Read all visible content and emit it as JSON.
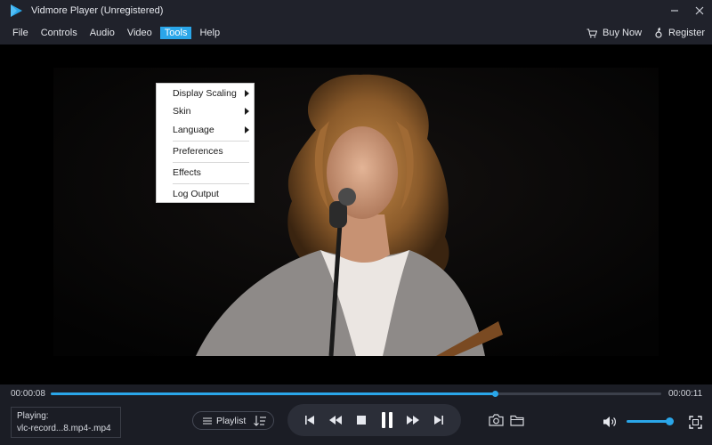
{
  "window": {
    "title": "Vidmore Player (Unregistered)",
    "controls": [
      "minimize-icon",
      "close-icon"
    ]
  },
  "menu": {
    "items": [
      {
        "label": "File"
      },
      {
        "label": "Controls"
      },
      {
        "label": "Audio"
      },
      {
        "label": "Video"
      },
      {
        "label": "Tools",
        "active": true
      },
      {
        "label": "Help"
      }
    ],
    "buy_label": "Buy Now",
    "register_label": "Register"
  },
  "tools_menu": {
    "items": [
      {
        "label": "Display Scaling",
        "submenu": true
      },
      {
        "label": "Skin",
        "submenu": true
      },
      {
        "label": "Language",
        "submenu": true
      },
      {
        "label": "Preferences",
        "submenu": false
      },
      {
        "label": "Effects",
        "submenu": false
      },
      {
        "label": "Log Output",
        "submenu": false
      }
    ]
  },
  "playback": {
    "current_time": "00:00:08",
    "total_time": "00:00:11",
    "progress": 0.727,
    "volume": 0.86
  },
  "now_playing": {
    "label": "Playing:",
    "file": "vlc-record...8.mp4-.mp4"
  },
  "playlist": {
    "label": "Playlist"
  },
  "colors": {
    "accent": "#2aa6e9",
    "background": "#1b1d25",
    "menu_bg": "#20222b"
  }
}
